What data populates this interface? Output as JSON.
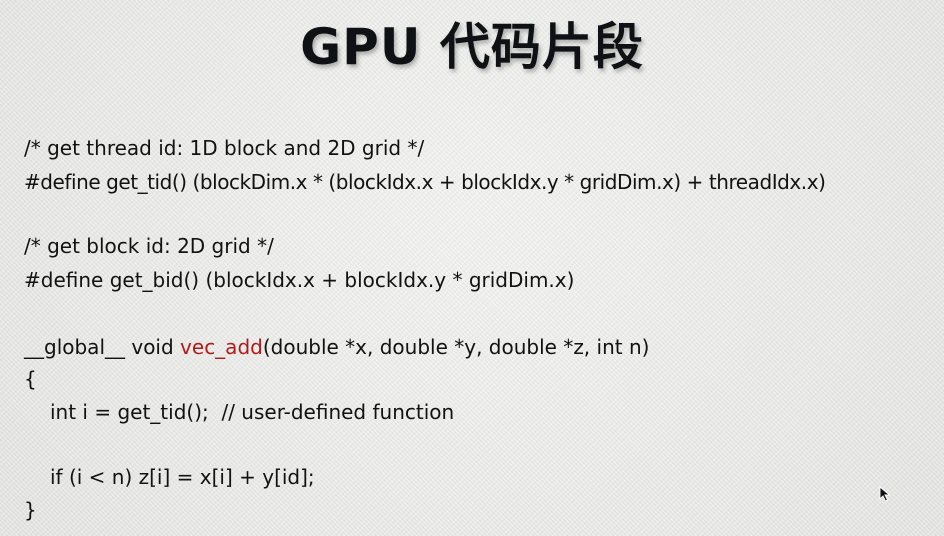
{
  "slide": {
    "title": "GPU 代码片段",
    "code": {
      "line1": "/* get thread id: 1D block and 2D grid */",
      "line2": "#define get_tid() (blockDim.x * (blockIdx.x + blockIdx.y * gridDim.x) + threadIdx.x)",
      "line3": "/* get block id: 2D grid */",
      "line4": "#define get_bid() (blockIdx.x + blockIdx.y * gridDim.x)",
      "line5_prefix": "__global__ void ",
      "line5_function": "vec_add",
      "line5_suffix": "(double *x, double *y, double *z, int n)",
      "line6": "{",
      "line7": "int i = get_tid();  // user-defined function",
      "line8": "if (i < n) z[i] = x[i] + y[id];",
      "line9": "}"
    }
  },
  "colors": {
    "text": "#121212",
    "function_name": "#b01c1c",
    "background": "#ececea"
  },
  "icons": {
    "cursor": "mouse-pointer-icon"
  }
}
